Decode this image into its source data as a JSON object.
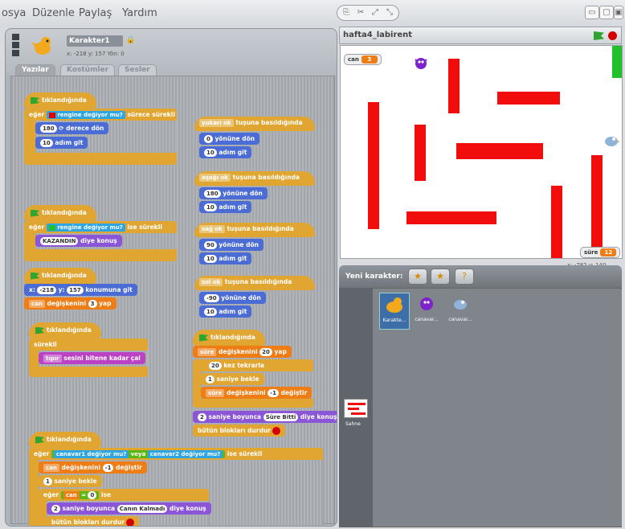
{
  "menu": {
    "items": [
      "osya",
      "Düzenle",
      "Paylaş",
      "Yardım"
    ]
  },
  "toolbar": {
    "group_icons": [
      "copy-stamp-icon",
      "delete-scissors-icon",
      "grow-icon",
      "shrink-icon"
    ]
  },
  "sprite": {
    "name": "Karakter1",
    "coords": "x: -218  y: 157   Yön: 0"
  },
  "tabs": [
    "Yazılar",
    "Kostümler",
    "Sesler"
  ],
  "scripts": {
    "s1": {
      "hat": "tıklandığında",
      "if_prefix": "eğer",
      "if_cond": "rengine değiyor mu?",
      "if_suffix": "sürece sürekli",
      "turn": "derece dön",
      "turn_val": "180",
      "move": "adım git",
      "move_val": "10"
    },
    "s2": {
      "hat": "tıklandığında",
      "if_prefix": "eğer",
      "if_cond": "rengine değiyor mu?",
      "if_suffix": "ise sürekli",
      "say_val": "KAZANDIN",
      "say": "diye konuş"
    },
    "s3": {
      "hat": "tıklandığında",
      "goto_prefix": "x:",
      "x_val": "-218",
      "goto_mid": "y:",
      "y_val": "157",
      "goto_suffix": "konumuna git",
      "var_name": "can",
      "set_mid": "değişkenini",
      "set_val": "3",
      "set_suffix": "yap"
    },
    "s4": {
      "hat": "tıklandığında",
      "forever": "sürekli",
      "sound_val": "tıpır",
      "sound": "sesini bitene kadar çal"
    },
    "k1": {
      "key": "yukarı ok",
      "hat": "tuşuna basıldığında",
      "dir_val": "0",
      "dir": "yönüne dön",
      "move_val": "10",
      "move": "adım git"
    },
    "k2": {
      "key": "aşağı ok",
      "hat": "tuşuna basıldığında",
      "dir_val": "180",
      "dir": "yönüne dön",
      "move_val": "10",
      "move": "adım git"
    },
    "k3": {
      "key": "sağ ok",
      "hat": "tuşuna basıldığında",
      "dir_val": "90",
      "dir": "yönüne dön",
      "move_val": "10",
      "move": "adım git"
    },
    "k4": {
      "key": "sol ok",
      "hat": "tuşuna basıldığında",
      "dir_val": "-90",
      "dir": "yönüne dön",
      "move_val": "10",
      "move": "adım git"
    },
    "s5": {
      "hat": "tıklandığında",
      "var_name": "süre",
      "set_mid": "değişkenini",
      "set_val": "20",
      "set_suffix": "yap",
      "repeat_val": "20",
      "repeat": "kez tekrarla",
      "wait_val": "1",
      "wait": "saniye bekle",
      "change_var": "süre",
      "change_mid": "değişkenini",
      "change_val": "-1",
      "change_suffix": "değiştir",
      "say_secs": "2",
      "say_prefix": "saniye boyunca",
      "say_val": "Süre Bitti",
      "say_suffix": "diye konuş",
      "stop": "bütün blokları durdur"
    },
    "s6": {
      "hat": "tıklandığında",
      "if_prefix": "eğer",
      "sprite_a": "canavar1",
      "touch_a": "değiyor mu?",
      "or": "veya",
      "sprite_b": "canavar2",
      "touch_b": "değiyor mu?",
      "if_suffix": "ise sürekli",
      "change_var": "can",
      "change_mid": "değişkenini",
      "change_val": "-1",
      "change_suffix": "değiştir",
      "wait_val": "1",
      "wait": "saniye bekle",
      "if2_prefix": "eğer",
      "cmp_var": "can",
      "cmp_op": "=",
      "cmp_val": "0",
      "if2_suffix": "ise",
      "say_secs": "2",
      "say_prefix": "saniye boyunca",
      "say_val": "Canın Kalmadı",
      "say_suffix": "diye konuş",
      "stop": "bütün blokları durdur"
    }
  },
  "stage": {
    "title": "hafta4_labirent",
    "monitor_can": {
      "label": "can",
      "value": "3"
    },
    "monitor_sure": {
      "label": "süre",
      "value": "12"
    },
    "mouse_coords": "x: -782  y: 140"
  },
  "sprites_panel": {
    "title": "Yeni karakter:",
    "sprites": [
      "Karakte...",
      "canavar...",
      "canavar..."
    ],
    "stage_label": "Sahne"
  },
  "colors": {
    "wall": "#f20d0d",
    "goal": "#22c02a",
    "control": "#e1a632",
    "motion": "#4a6cd4"
  }
}
